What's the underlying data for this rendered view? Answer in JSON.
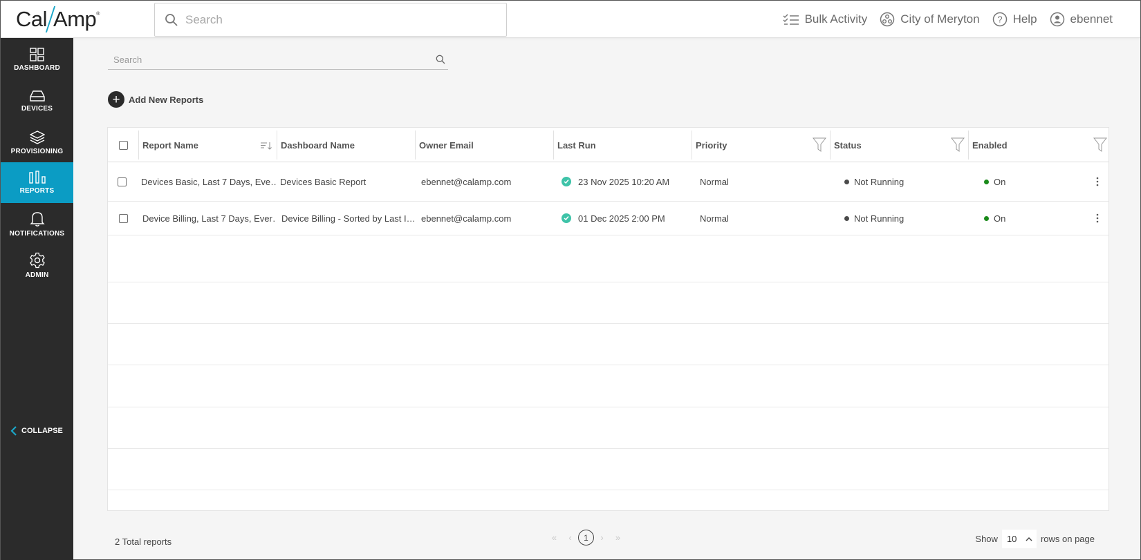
{
  "header": {
    "logo_left": "Cal",
    "logo_right": "Amp",
    "logo_mark": "®",
    "search_placeholder": "Search",
    "bulk_activity": "Bulk Activity",
    "organization": "City of Meryton",
    "help": "Help",
    "username": "ebennet"
  },
  "sidebar": {
    "items": [
      {
        "label": "DASHBOARD",
        "icon": "dashboard-icon"
      },
      {
        "label": "DEVICES",
        "icon": "devices-icon"
      },
      {
        "label": "PROVISIONING",
        "icon": "layers-icon"
      },
      {
        "label": "REPORTS",
        "icon": "reports-icon",
        "active": true
      },
      {
        "label": "NOTIFICATIONS",
        "icon": "bell-icon"
      },
      {
        "label": "ADMIN",
        "icon": "gear-icon"
      }
    ],
    "collapse_label": "COLLAPSE"
  },
  "main": {
    "search_placeholder": "Search",
    "add_label": "Add New Reports",
    "columns": [
      "Report Name",
      "Dashboard Name",
      "Owner Email",
      "Last Run",
      "Priority",
      "Status",
      "Enabled"
    ],
    "rows": [
      {
        "report_name": "Devices Basic, Last 7 Days, Eve…",
        "dashboard_name": "Devices Basic Report",
        "owner_email": "ebennet@calamp.com",
        "last_run": "23 Nov 2025 10:20 AM",
        "priority": "Normal",
        "status": "Not Running",
        "enabled": "On"
      },
      {
        "report_name": "Device Billing, Last 7 Days, Ever…",
        "dashboard_name": "Device Billing - Sorted by Last I…",
        "owner_email": "ebennet@calamp.com",
        "last_run": "01 Dec 2025 2:00 PM",
        "priority": "Normal",
        "status": "Not Running",
        "enabled": "On"
      }
    ],
    "total_text": "2 Total reports",
    "pager": {
      "current_page": "1",
      "first": "«",
      "prev": "‹",
      "next": "›",
      "last": "»"
    },
    "rows_per_page": {
      "show": "Show",
      "value": "10",
      "suffix": "rows on page"
    }
  },
  "colors": {
    "sidebar_bg": "#2b2b2b",
    "active_nav": "#0b9cc4",
    "success_check": "#3ec3a8",
    "status_not_running": "#4a4a4a",
    "enabled_on": "#1a8a1a"
  }
}
